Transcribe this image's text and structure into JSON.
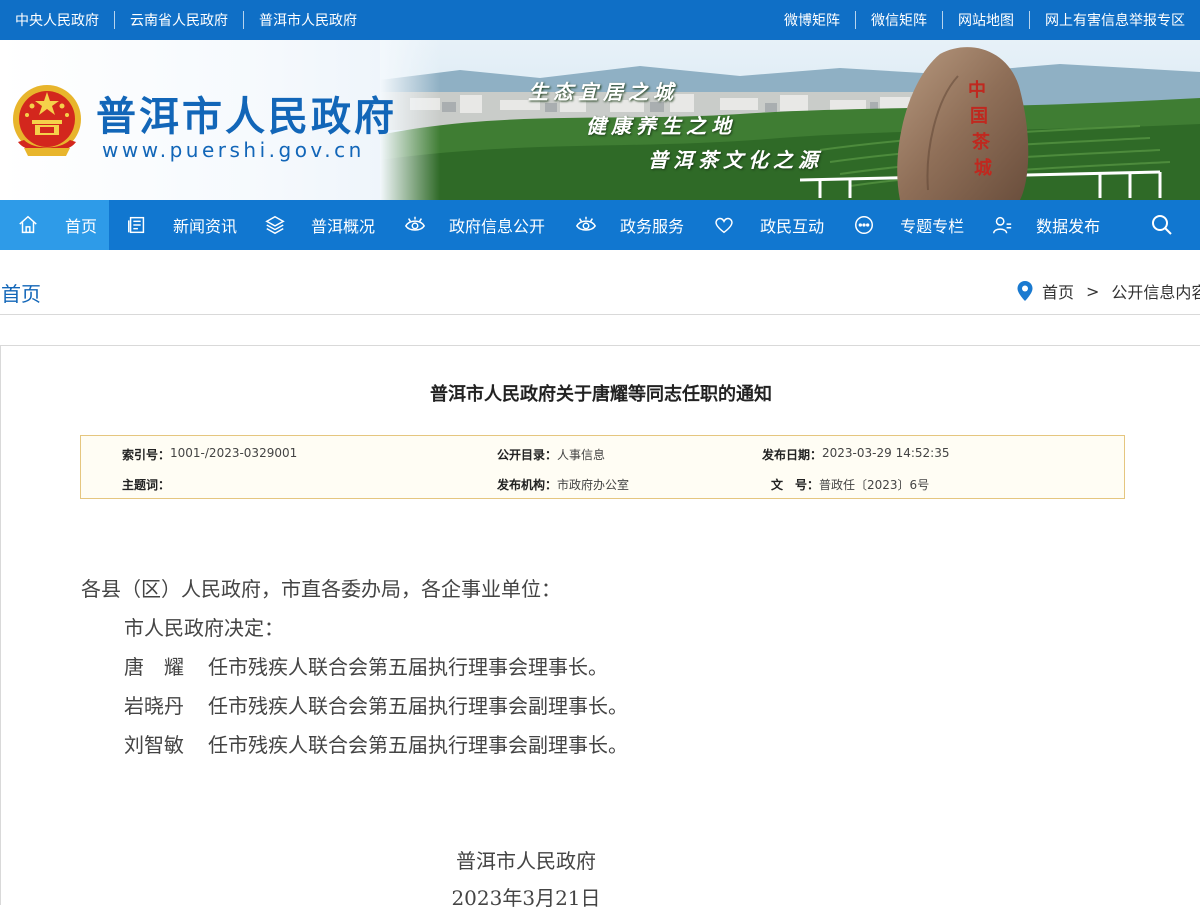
{
  "top_links": {
    "left": [
      "中央人民政府",
      "云南省人民政府",
      "普洱市人民政府"
    ],
    "right": [
      "微博矩阵",
      "微信矩阵",
      "网站地图",
      "网上有害信息举报专区"
    ]
  },
  "banner": {
    "site_title": "普洱市人民政府",
    "site_url": "www.puershi.gov.cn",
    "slogans": [
      "生态宜居之城",
      "健康养生之地",
      "普洱茶文化之源"
    ],
    "rock_text": "中国茶城"
  },
  "nav": {
    "items": [
      {
        "label": "首页",
        "icon": "home-icon",
        "active": true
      },
      {
        "label": "新闻资讯",
        "icon": "news-icon",
        "active": false
      },
      {
        "label": "普洱概况",
        "icon": "layers-icon",
        "active": false
      },
      {
        "label": "政府信息公开",
        "icon": "eye-icon",
        "active": false
      },
      {
        "label": "政务服务",
        "icon": "eye-icon",
        "active": false
      },
      {
        "label": "政民互动",
        "icon": "heart-icon",
        "active": false
      },
      {
        "label": "专题专栏",
        "icon": "chat-icon",
        "active": false
      },
      {
        "label": "数据发布",
        "icon": "user-icon",
        "active": false
      }
    ],
    "search_icon": "search-icon"
  },
  "breadcrumb": {
    "section_title": "首页",
    "path_home": "首页",
    "separator": ">",
    "path_current": "公开信息内容"
  },
  "article": {
    "title": "普洱市人民政府关于唐耀等同志任职的通知",
    "meta": {
      "index_label": "索引号：",
      "index_value": "1001-/2023-0329001",
      "catalog_label": "公开目录：",
      "catalog_value": "人事信息",
      "date_label": "发布日期：",
      "date_value": "2023-03-29 14:52:35",
      "subject_label": "主题词：",
      "subject_value": "",
      "org_label": "发布机构：",
      "org_value": "市政府办公室",
      "docno_label": "文　号：",
      "docno_value": "普政任〔2023〕6号"
    },
    "salutation": "各县（区）人民政府，市直各委办局，各企事业单位：",
    "decision": "市人民政府决定：",
    "appointments": [
      {
        "name": "唐　耀",
        "duty": "任市残疾人联合会第五届执行理事会理事长。"
      },
      {
        "name": "岩晓丹",
        "duty": "任市残疾人联合会第五届执行理事会副理事长。"
      },
      {
        "name": "刘智敏",
        "duty": "任市残疾人联合会第五届执行理事会副理事长。"
      }
    ],
    "signature": "普洱市人民政府",
    "sign_date": "2023年3月21日"
  },
  "colors": {
    "topbar": "#0f6fc6",
    "nav": "#1177d0",
    "nav_active": "#2e9be8",
    "brand_text": "#1266b8",
    "meta_border": "#e5c67f",
    "meta_bg": "#fffdf4"
  }
}
